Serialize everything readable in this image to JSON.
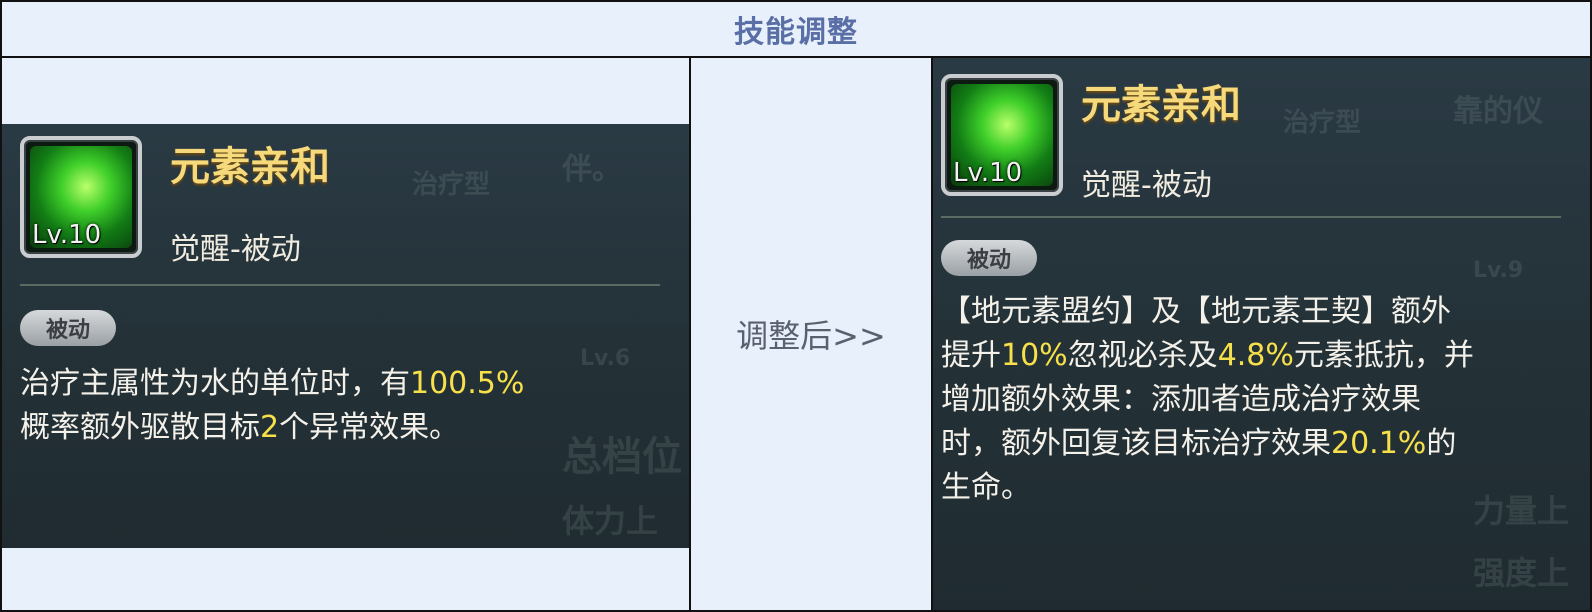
{
  "header": {
    "title": "技能调整"
  },
  "middle": {
    "label": "调整后>>"
  },
  "before": {
    "icon_level": "Lv.10",
    "skill_name": "元素亲和",
    "skill_type": "觉醒-被动",
    "badge": "被动",
    "desc": {
      "line1_a": "治疗主属性为水的单位时，有",
      "line1_hl": "100.5%",
      "line2_a": "概率额外驱散目标",
      "line2_hl": "2",
      "line2_b": "个异常效果。"
    },
    "ghost": [
      "治疗型",
      "伴。",
      "总档位",
      "体力上",
      "Lv.6"
    ]
  },
  "after": {
    "icon_level": "Lv.10",
    "skill_name": "元素亲和",
    "skill_type": "觉醒-被动",
    "badge": "被动",
    "desc": {
      "line1": "【地元素盟约】及【地元素王契】额外",
      "line2_a": "提升",
      "line2_hl1": "10%",
      "line2_b": "忽视必杀及",
      "line2_hl2": "4.8%",
      "line2_c": "元素抵抗，并",
      "line3": "增加额外效果：添加者造成治疗效果",
      "line4_a": "时，额外回复该目标治疗效果",
      "line4_hl": "20.1%",
      "line4_b": "的",
      "line5": "生命。"
    },
    "ghost": [
      "治疗型",
      "靠的仪",
      "Lv.9",
      "力量上",
      "强度上"
    ]
  },
  "colors": {
    "header_text": "#5a6fa6",
    "highlight": "#f7e04a",
    "skill_name": "#f5d97a",
    "table_bg": "#e8f0fb"
  }
}
